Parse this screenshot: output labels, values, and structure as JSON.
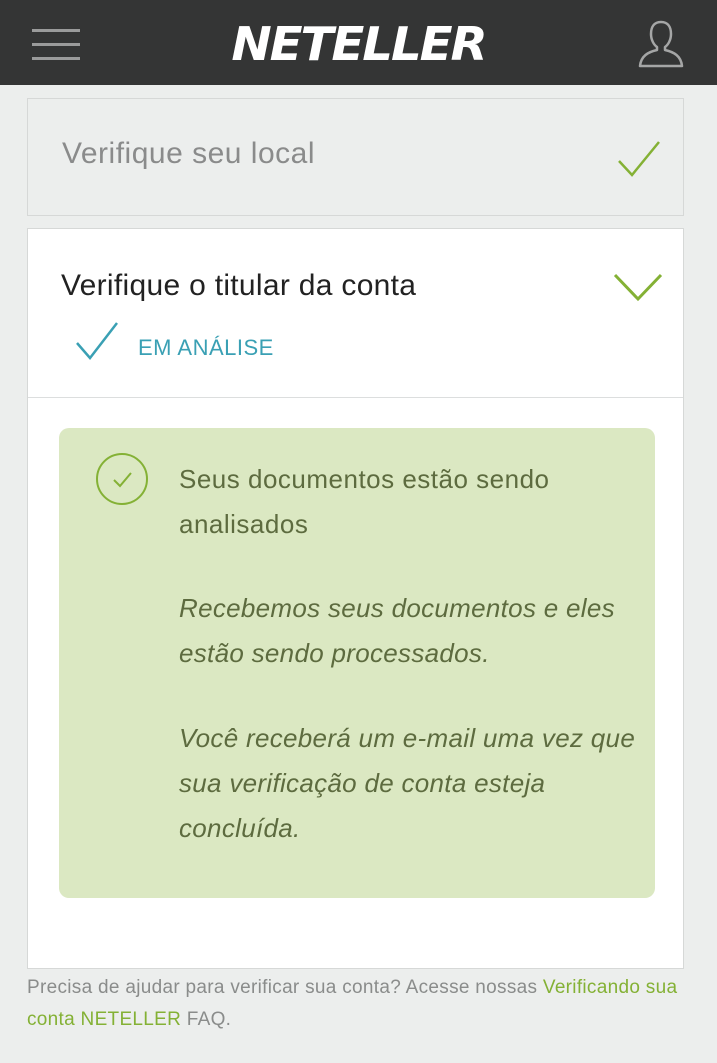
{
  "header": {
    "logo_text": "NETELLER",
    "menu_icon": "hamburger-menu-icon",
    "profile_icon": "user-profile-icon",
    "background_color": "#343535"
  },
  "steps": [
    {
      "title": "Verifique seu local",
      "status_icon": "checkmark-icon",
      "completed": true
    },
    {
      "title": "Verifique o titular da conta",
      "expanded": true,
      "status_label": "EM ANÁLISE",
      "status_icon": "checkmark-icon",
      "expand_icon": "chevron-down-icon"
    }
  ],
  "notice": {
    "icon": "circle-check-icon",
    "title": "Seus documentos estão sendo analisados",
    "paragraph1": "Recebemos seus documentos e eles estão sendo processados.",
    "paragraph2": "Você receberá um e-mail uma vez que sua verificação de conta esteja concluída.",
    "background_color": "#dbe8c2"
  },
  "footer": {
    "text": "Precisa de ajudar para verificar sua conta? Acesse nossas ",
    "link_text": "Verificando sua conta NETELLER",
    "suffix": " FAQ."
  },
  "colors": {
    "accent_green": "#84b135",
    "status_blue": "#3aa0b4"
  }
}
